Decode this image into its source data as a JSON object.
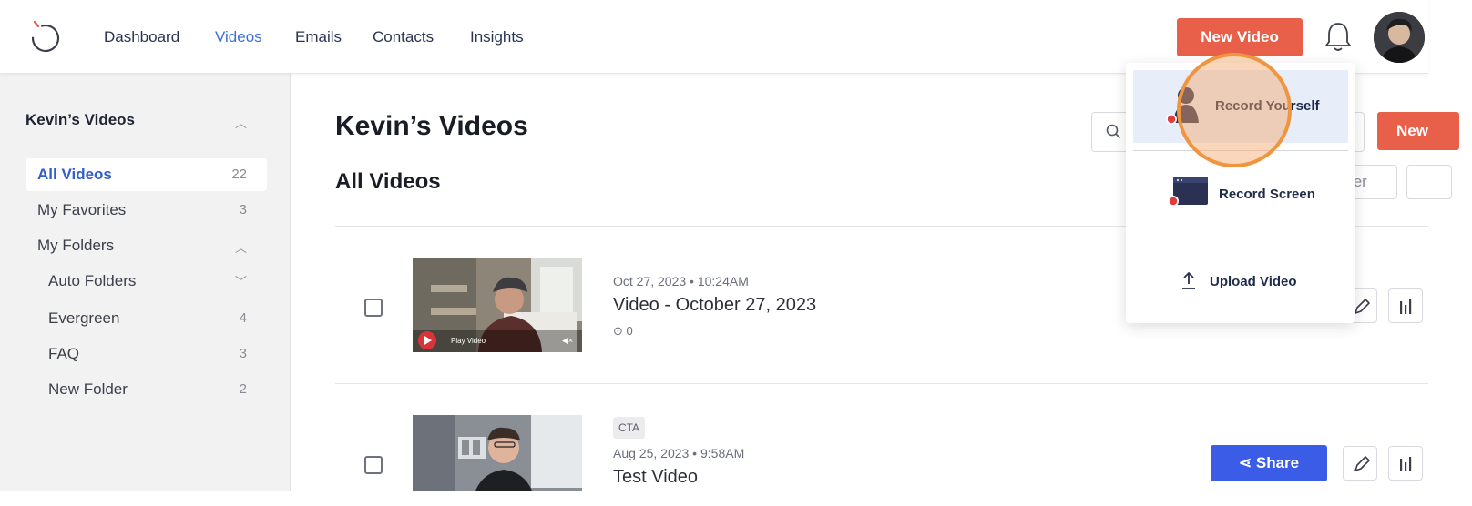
{
  "nav": {
    "links": [
      "Dashboard",
      "Videos",
      "Emails",
      "Contacts",
      "Insights"
    ],
    "active": "Videos",
    "new_video_label": "New Video"
  },
  "sidebar": {
    "title": "Kevin’s Videos",
    "items": [
      {
        "label": "All Videos",
        "count": "22"
      },
      {
        "label": "My Favorites",
        "count": "3"
      },
      {
        "label": "My Folders",
        "count": ""
      },
      {
        "label": "Auto Folders",
        "count": ""
      },
      {
        "label": "Evergreen",
        "count": "4"
      },
      {
        "label": "FAQ",
        "count": "3"
      },
      {
        "label": "New Folder",
        "count": "2"
      }
    ]
  },
  "main": {
    "page_title": "Kevin’s Videos",
    "section_title": "All Videos",
    "right_new_label": "New",
    "filter_label": "ter"
  },
  "videos": [
    {
      "date": "Oct 27, 2023 • 10:24AM",
      "title": "Video - October 27, 2023",
      "views": "0",
      "play_label": "Play Video"
    },
    {
      "tag": "CTA",
      "date": "Aug 25, 2023 • 9:58AM",
      "title": "Test Video",
      "share_label": "Share"
    }
  ],
  "dropdown": {
    "items": [
      {
        "label": "Record Yourself"
      },
      {
        "label": "Record Screen"
      },
      {
        "label": "Upload Video"
      }
    ]
  },
  "colors": {
    "accent_red": "#e8604a",
    "link_blue": "#3a6fd8",
    "share_blue": "#3b5ce6",
    "cursor_orange": "#f0953f"
  }
}
